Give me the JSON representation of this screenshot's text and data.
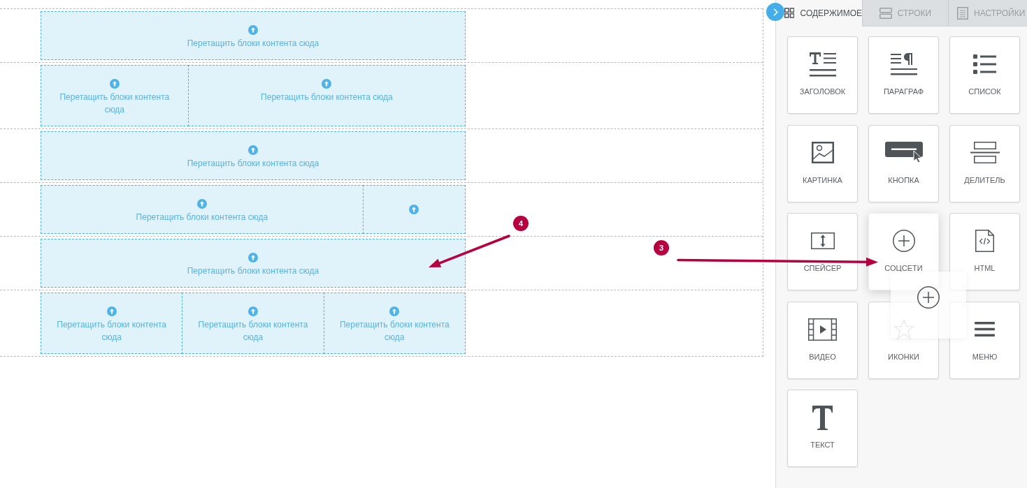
{
  "canvas": {
    "rows": [
      {
        "kind": "one",
        "columns": [
          {
            "kind": "placeholder",
            "text": "Перетащить блоки контента сюда"
          }
        ]
      },
      {
        "kind": "one-two",
        "columns": [
          {
            "kind": "placeholder",
            "text": "Перетащить блоки контента сюда"
          },
          {
            "kind": "placeholder",
            "text": "Перетащить блоки контента сюда"
          }
        ]
      },
      {
        "kind": "one",
        "columns": [
          {
            "kind": "placeholder",
            "text": "Перетащить блоки контента сюда"
          }
        ]
      },
      {
        "kind": "three-one",
        "columns": [
          {
            "kind": "placeholder",
            "text": "Перетащить блоки контента сюда"
          },
          {
            "kind": "icon-only"
          }
        ]
      },
      {
        "kind": "one",
        "columns": [
          {
            "kind": "placeholder",
            "text": "Перетащить блоки контента сюда"
          }
        ]
      },
      {
        "kind": "three",
        "columns": [
          {
            "kind": "placeholder",
            "text": "Перетащить блоки контента сюда"
          },
          {
            "kind": "placeholder",
            "text": "Перетащить блоки контента сюда"
          },
          {
            "kind": "placeholder",
            "text": "Перетащить блоки контента сюда"
          }
        ]
      }
    ]
  },
  "annotations": [
    {
      "label": "4"
    },
    {
      "label": "3"
    }
  ],
  "panel": {
    "tabs": [
      {
        "kind": "content",
        "label": "СОДЕРЖИМОЕ",
        "selected": true
      },
      {
        "kind": "rows",
        "label": "СТРОКИ",
        "selected": false
      },
      {
        "kind": "settings",
        "label": "НАСТРОЙКИ",
        "selected": false
      }
    ],
    "tiles": [
      {
        "kind": "heading",
        "label": "ЗАГОЛОВОК",
        "dragging": false
      },
      {
        "kind": "paragraph",
        "label": "ПАРАГРАФ",
        "dragging": false
      },
      {
        "kind": "list",
        "label": "СПИСОК",
        "dragging": false
      },
      {
        "kind": "image",
        "label": "КАРТИНКА",
        "dragging": false
      },
      {
        "kind": "button",
        "label": "КНОПКА",
        "dragging": false
      },
      {
        "kind": "divider",
        "label": "ДЕЛИТЕЛЬ",
        "dragging": false
      },
      {
        "kind": "spacer",
        "label": "СПЕЙСЕР",
        "dragging": false
      },
      {
        "kind": "social",
        "label": "СОЦСЕТИ",
        "dragging": true
      },
      {
        "kind": "html",
        "label": "HTML",
        "dragging": false
      },
      {
        "kind": "video",
        "label": "ВИДЕО",
        "dragging": false
      },
      {
        "kind": "icons",
        "label": "ИКОНКИ",
        "dragging": false
      },
      {
        "kind": "menu",
        "label": "МЕНЮ",
        "dragging": false
      },
      {
        "kind": "text",
        "label": "ТЕКСТ",
        "dragging": false
      }
    ]
  }
}
